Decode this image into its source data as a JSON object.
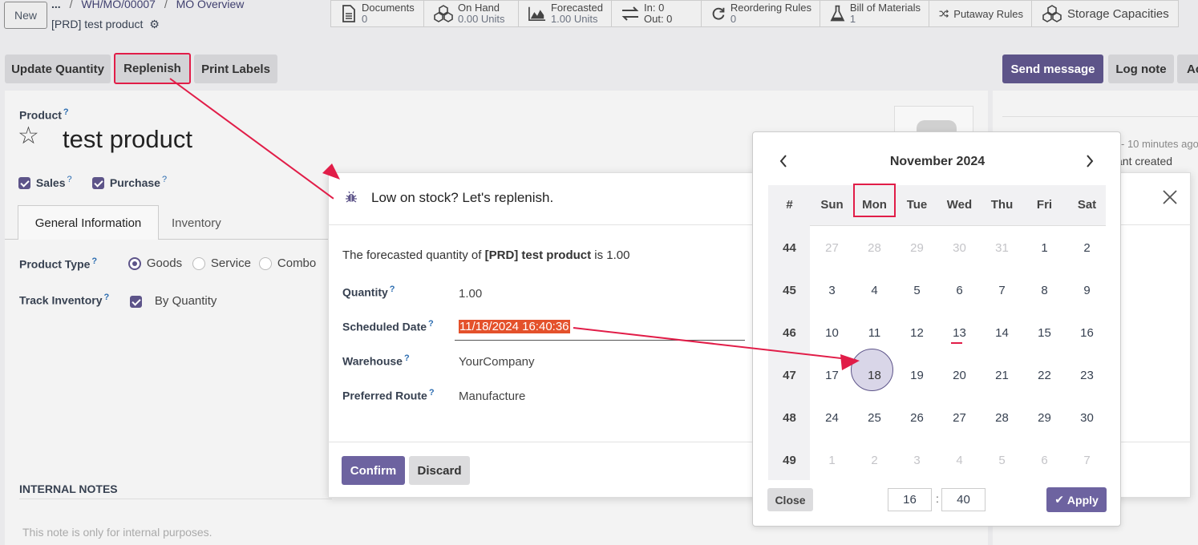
{
  "header": {
    "new_label": "New",
    "breadcrumb_dots": "...",
    "breadcrumb": [
      "WH/MO/00007",
      "MO Overview"
    ],
    "record_title": "[PRD] test product"
  },
  "smart_buttons": [
    {
      "title": "Documents",
      "value": "0",
      "icon": "document-icon"
    },
    {
      "title": "On Hand",
      "value": "0.00 Units",
      "icon": "cubes-icon"
    },
    {
      "title": "Forecasted",
      "value": "1.00 Units",
      "icon": "area-chart-icon"
    },
    {
      "title": "In: 0",
      "value": "Out: 0",
      "icon": "exchange-icon"
    },
    {
      "title": "Reordering Rules",
      "value": "0",
      "icon": "refresh-icon"
    },
    {
      "title": "Bill of Materials",
      "value": "1",
      "icon": "flask-icon"
    },
    {
      "title": "Putaway Rules",
      "value": "",
      "icon": "random-icon"
    },
    {
      "title": "Storage Capacities",
      "value": "",
      "icon": "cubes-icon"
    }
  ],
  "actions": {
    "update_qty": "Update Quantity",
    "replenish": "Replenish",
    "print_labels": "Print Labels",
    "send_message": "Send message",
    "log_note": "Log note",
    "activities": "Ac"
  },
  "form": {
    "product_label": "Product",
    "product_name": "test product",
    "sales": "Sales",
    "purchase": "Purchase",
    "tab_general": "General Information",
    "tab_inventory": "Inventory",
    "product_type_label": "Product Type",
    "type_goods": "Goods",
    "type_service": "Service",
    "type_combo": "Combo",
    "track_label": "Track Inventory",
    "track_value": "By Quantity",
    "notes_label": "INTERNAL NOTES",
    "notes_placeholder": "This note is only for internal purposes."
  },
  "chatter": {
    "time": "- 10 minutes ago",
    "msg": "ant created"
  },
  "modal": {
    "title": "Low on stock? Let's replenish.",
    "desc_pre": "The forecasted quantity of ",
    "desc_product": "[PRD] test product",
    "desc_post": " is 1.00",
    "quantity_label": "Quantity",
    "quantity_value": "1.00",
    "date_label": "Scheduled Date",
    "date_value": "11/18/2024 16:40:36",
    "warehouse_label": "Warehouse",
    "warehouse_value": "YourCompany",
    "route_label": "Preferred Route",
    "route_value": "Manufacture",
    "confirm": "Confirm",
    "discard": "Discard"
  },
  "datepicker": {
    "month": "November 2024",
    "week_header": "#",
    "days": [
      "Sun",
      "Mon",
      "Tue",
      "Wed",
      "Thu",
      "Fri",
      "Sat"
    ],
    "weeks": [
      {
        "num": "44",
        "days": [
          "27",
          "28",
          "29",
          "30",
          "31",
          "1",
          "2"
        ],
        "muted": [
          0,
          1,
          2,
          3,
          4
        ]
      },
      {
        "num": "45",
        "days": [
          "3",
          "4",
          "5",
          "6",
          "7",
          "8",
          "9"
        ],
        "muted": []
      },
      {
        "num": "46",
        "days": [
          "10",
          "11",
          "12",
          "13",
          "14",
          "15",
          "16"
        ],
        "muted": []
      },
      {
        "num": "47",
        "days": [
          "17",
          "18",
          "19",
          "20",
          "21",
          "22",
          "23"
        ],
        "muted": []
      },
      {
        "num": "48",
        "days": [
          "24",
          "25",
          "26",
          "27",
          "28",
          "29",
          "30"
        ],
        "muted": []
      },
      {
        "num": "49",
        "days": [
          "1",
          "2",
          "3",
          "4",
          "5",
          "6",
          "7"
        ],
        "muted": [
          0,
          1,
          2,
          3,
          4,
          5,
          6
        ]
      }
    ],
    "hour": "16",
    "minute": "40",
    "close": "Close",
    "apply": "Apply"
  },
  "colors": {
    "accent": "#5d5489",
    "highlight": "#e11d48",
    "date_selection": "#e4512b"
  }
}
